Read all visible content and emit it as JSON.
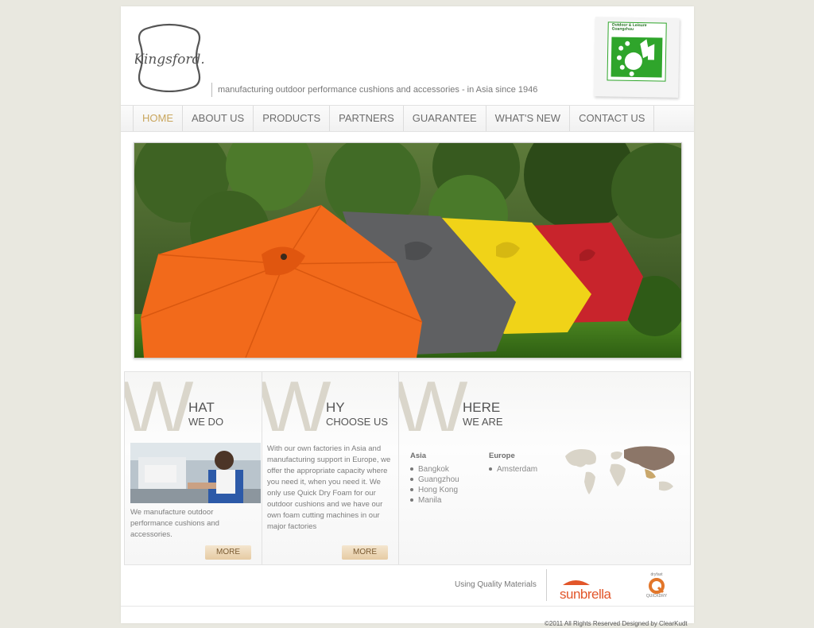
{
  "header": {
    "logo_text": "Kingsford.",
    "tagline": "manufacturing outdoor performance cushions and accessories - in Asia since 1946",
    "badge_title": "Outdoor & Leisure Guangzhou"
  },
  "nav": {
    "items": [
      "HOME",
      "ABOUT US",
      "PRODUCTS",
      "PARTNERS",
      "GUARANTEE",
      "WHAT'S NEW",
      "CONTACT US"
    ],
    "active": "HOME"
  },
  "columns": {
    "what": {
      "big_letter": "W",
      "heading_1": "HAT",
      "heading_2": "WE DO",
      "text": "We manufacture outdoor performance cushions and accessories.",
      "more_label": "MORE"
    },
    "why": {
      "big_letter": "W",
      "heading_1": "HY",
      "heading_2": "CHOOSE US",
      "text": "With our own factories in Asia and manufacturing support in Europe, we offer the appropriate capacity where you need it, when you need it. We only use Quick Dry Foam for our outdoor cushions and we have our own foam cutting machines in our major factories",
      "more_label": "MORE"
    },
    "where": {
      "big_letter": "W",
      "heading_1": "HERE",
      "heading_2": "WE ARE",
      "asia_label": "Asia",
      "asia_cities": [
        "Bangkok",
        "Guangzhou",
        "Hong Kong",
        "Manila"
      ],
      "europe_label": "Europe",
      "europe_cities": [
        "Amsterdam"
      ]
    }
  },
  "footer": {
    "quality_label": "Using Quality Materials",
    "sunbrella_label": "sunbrella",
    "q_label_small": "dryfast",
    "q_label": "QUICKDRY",
    "copyright": "©2011 All Rights Reserved Designed by ClearKudt"
  },
  "colors": {
    "background": "#e9e8e0",
    "nav_active": "#c9a65d",
    "sunbrella": "#e2562a",
    "badge_green": "#2fa52b"
  }
}
